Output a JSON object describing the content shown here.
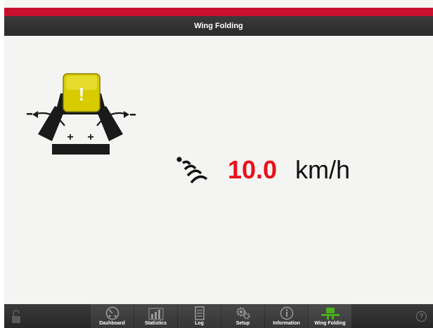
{
  "header": {
    "title": "Wing Folding"
  },
  "speed": {
    "value": "10.0",
    "unit": "km/h"
  },
  "wing_graphic": {
    "warning_symbol": "!",
    "plus_left": "+",
    "plus_right": "+"
  },
  "nav": {
    "items": [
      {
        "label": "Dashboard",
        "icon": "gauge-icon",
        "active": false
      },
      {
        "label": "Statistics",
        "icon": "bar-chart-icon",
        "active": false
      },
      {
        "label": "Log",
        "icon": "document-icon",
        "active": false
      },
      {
        "label": "Setup",
        "icon": "gears-icon",
        "active": false
      },
      {
        "label": "Information",
        "icon": "info-icon",
        "active": false
      },
      {
        "label": "Wing Folding",
        "icon": "wing-folding-icon",
        "active": true
      }
    ],
    "help_symbol": "?"
  },
  "colors": {
    "brand_red": "#c8102e",
    "speed_red": "#e8101c",
    "warning_yellow": "#d8cc00",
    "active_green": "#4caf1f"
  }
}
